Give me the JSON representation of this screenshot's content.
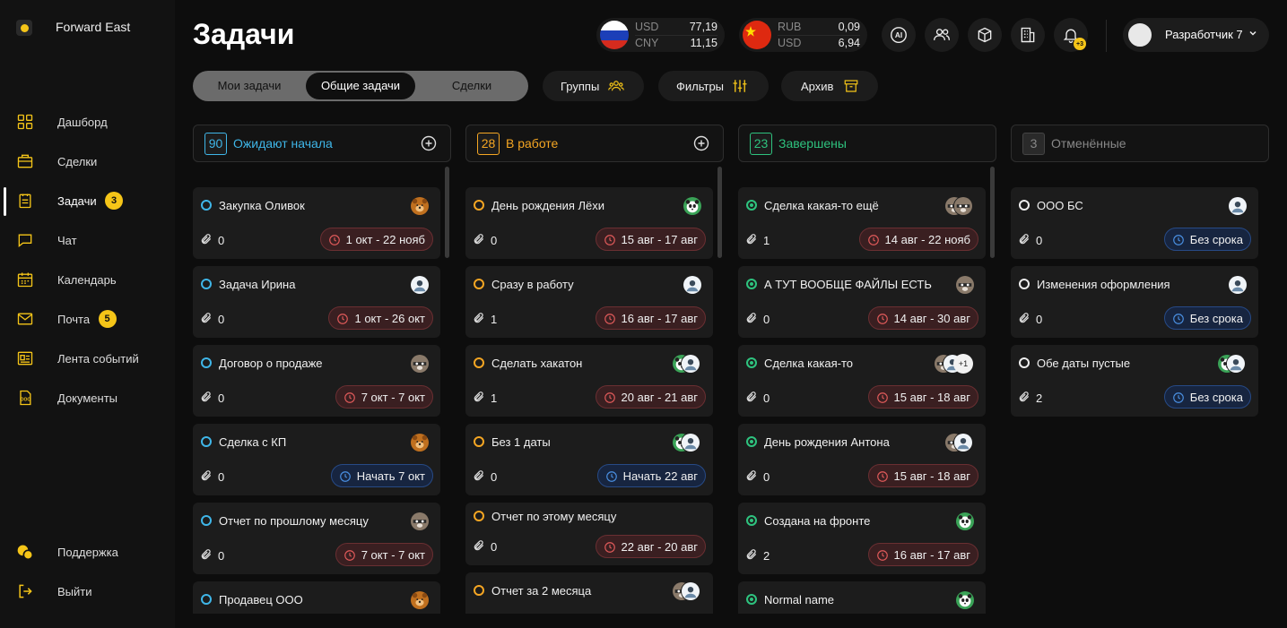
{
  "app": {
    "brand": "Forward East"
  },
  "sidebar": {
    "items": [
      {
        "label": "Дашборд",
        "icon": "dashboard-icon"
      },
      {
        "label": "Сделки",
        "icon": "briefcase-icon"
      },
      {
        "label": "Задачи",
        "icon": "tasks-icon",
        "badge": "3",
        "active": true
      },
      {
        "label": "Чат",
        "icon": "chat-icon"
      },
      {
        "label": "Календарь",
        "icon": "calendar-icon"
      },
      {
        "label": "Почта",
        "icon": "mail-icon",
        "badge": "5"
      },
      {
        "label": "Лента событий",
        "icon": "feed-icon"
      },
      {
        "label": "Документы",
        "icon": "doc-icon"
      }
    ],
    "support": "Поддержка",
    "logout": "Выйти"
  },
  "header": {
    "title": "Задачи",
    "rates": [
      {
        "c1": "USD",
        "v1": "77,19",
        "c2": "CNY",
        "v2": "11,15",
        "flag": "russia-flag-icon"
      },
      {
        "c1": "RUB",
        "v1": "0,09",
        "c2": "USD",
        "v2": "6,94",
        "flag": "china-flag-icon"
      }
    ],
    "icons": [
      "ai-icon",
      "users-icon",
      "box-icon",
      "building-icon",
      "bell-icon"
    ],
    "notifications": "+3",
    "user": "Разработчик 7"
  },
  "tabs": {
    "mine": "Мои задачи",
    "common": "Общие задачи",
    "deals": "Сделки",
    "active": "common"
  },
  "filters": {
    "groups": "Группы",
    "filters": "Фильтры",
    "archive": "Архив"
  },
  "colors": {
    "accent": "#f5c518",
    "waiting": "#3fb6e8",
    "inwork": "#f5a623",
    "done": "#2ec27e",
    "cancel": "#eeeeee"
  },
  "columns": [
    {
      "key": "waiting",
      "count": "90",
      "title": "Ожидают начала",
      "plus": true,
      "cards": [
        {
          "title": "Закупка Оливок",
          "files": "0",
          "date": "1 окт - 22 нояб",
          "date_type": "red",
          "avatars": [
            "bear"
          ]
        },
        {
          "title": "Задача Ирина",
          "files": "0",
          "date": "1 окт - 26 окт",
          "date_type": "red",
          "avatars": [
            "person"
          ]
        },
        {
          "title": "Договор о продаже",
          "files": "0",
          "date": "7 окт - 7 окт",
          "date_type": "red",
          "avatars": [
            "raccoon"
          ]
        },
        {
          "title": "Сделка с КП",
          "files": "0",
          "date": "Начать 7 окт",
          "date_type": "blue",
          "avatars": [
            "bear"
          ]
        },
        {
          "title": "Отчет по прошлому месяцу",
          "files": "0",
          "date": "7 окт - 7 окт",
          "date_type": "red",
          "avatars": [
            "raccoon"
          ]
        },
        {
          "title": "Продавец ООО",
          "files": "",
          "date": "",
          "date_type": "red",
          "avatars": [
            "bear"
          ]
        }
      ]
    },
    {
      "key": "inwork",
      "count": "28",
      "title": "В работе",
      "plus": true,
      "cards": [
        {
          "title": "День рождения Лёхи",
          "files": "0",
          "date": "15 авг - 17 авг",
          "date_type": "red",
          "avatars": [
            "panda"
          ]
        },
        {
          "title": "Сразу в работу",
          "files": "1",
          "date": "16 авг - 17 авг",
          "date_type": "red",
          "avatars": [
            "person"
          ]
        },
        {
          "title": "Сделать хакатон",
          "files": "1",
          "date": "20 авг - 21 авг",
          "date_type": "red",
          "avatars": [
            "panda",
            "person"
          ]
        },
        {
          "title": "Без 1 даты",
          "files": "0",
          "date": "Начать 22 авг",
          "date_type": "blue",
          "avatars": [
            "panda",
            "person"
          ]
        },
        {
          "title": "Отчет по этому месяцу",
          "files": "0",
          "date": "22 авг - 20 авг",
          "date_type": "red",
          "avatars": []
        },
        {
          "title": "Отчет за 2 месяца",
          "files": "",
          "date": "",
          "date_type": "red",
          "avatars": [
            "raccoon",
            "person"
          ]
        }
      ]
    },
    {
      "key": "done",
      "count": "23",
      "title": "Завершены",
      "plus": false,
      "cards": [
        {
          "title": "Сделка какая-то ещё",
          "files": "1",
          "date": "14 авг - 22 нояб",
          "date_type": "red",
          "avatars": [
            "raccoon",
            "raccoon"
          ]
        },
        {
          "title": "А ТУТ ВООБЩЕ ФАЙЛЫ ЕСТЬ",
          "files": "0",
          "date": "14 авг - 30 авг",
          "date_type": "red",
          "avatars": [
            "raccoon"
          ]
        },
        {
          "title": "Сделка какая-то",
          "files": "0",
          "date": "15 авг - 18 авг",
          "date_type": "red",
          "avatars": [
            "raccoon",
            "person"
          ],
          "more": "+1"
        },
        {
          "title": "День рождения Антона",
          "files": "0",
          "date": "15 авг - 18 авг",
          "date_type": "red",
          "avatars": [
            "raccoon",
            "person"
          ]
        },
        {
          "title": "Создана на фронте",
          "files": "2",
          "date": "16 авг - 17 авг",
          "date_type": "red",
          "avatars": [
            "panda"
          ]
        },
        {
          "title": "Normal name",
          "files": "",
          "date": "",
          "date_type": "red",
          "avatars": [
            "panda"
          ]
        }
      ]
    },
    {
      "key": "cancel",
      "count": "3",
      "title": "Отменённые",
      "plus": false,
      "cards": [
        {
          "title": "ООО БС",
          "files": "0",
          "date": "Без срока",
          "date_type": "blue",
          "avatars": [
            "person"
          ]
        },
        {
          "title": "Изменения оформления",
          "files": "0",
          "date": "Без срока",
          "date_type": "blue",
          "avatars": [
            "person"
          ]
        },
        {
          "title": "Обе даты пустые",
          "files": "2",
          "date": "Без срока",
          "date_type": "blue",
          "avatars": [
            "panda",
            "person"
          ]
        }
      ]
    }
  ]
}
